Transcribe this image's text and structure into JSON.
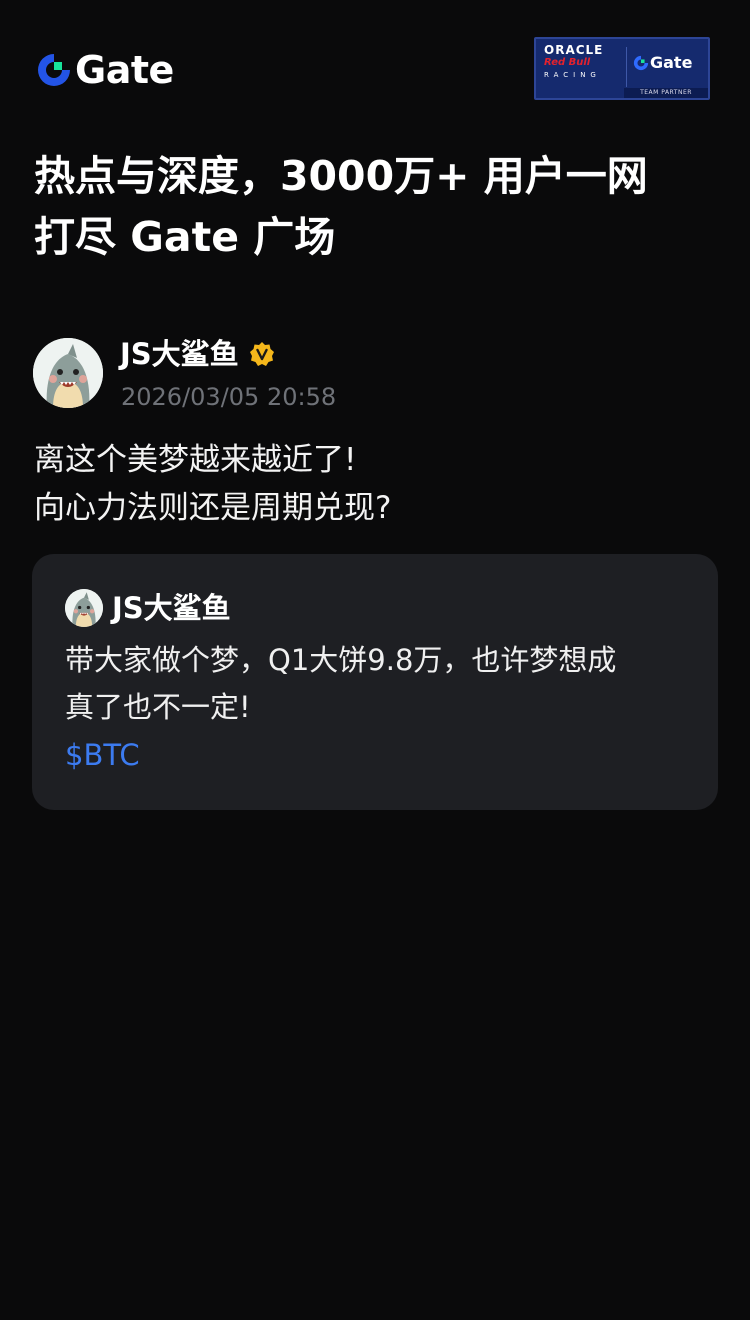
{
  "brand": {
    "logo_text": "Gate",
    "accent_color": "#2354e6",
    "green_accent": "#17e39a"
  },
  "partner_badge": {
    "oracle": "ORACLE",
    "redbull": "Red Bull",
    "racing": "RACING",
    "gate": "Gate",
    "team_partner": "TEAM PARTNER"
  },
  "headline": {
    "line1": "热点与深度，3000万+ 用户一网",
    "line2": "打尽 Gate 广场"
  },
  "post": {
    "author": "JS大鲨鱼",
    "verified_icon": "verified-badge-icon",
    "timestamp": "2026/03/05 20:58",
    "lines": [
      "离这个美梦越来越近了!",
      "向心力法则还是周期兑现?"
    ]
  },
  "quoted_post": {
    "author": "JS大鲨鱼",
    "lines": [
      "带大家做个梦，Q1大饼9.8万，也许梦想成",
      "真了也不一定!"
    ],
    "tag": "$BTC",
    "tag_color": "#3c7bf0"
  }
}
